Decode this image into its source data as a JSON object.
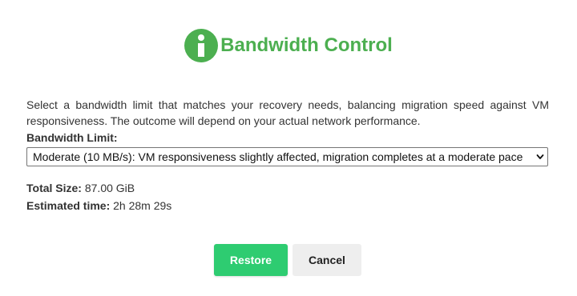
{
  "dialog": {
    "title": "Bandwidth Control",
    "icon": "info-icon",
    "accent_color": "#4caf50",
    "description": "Select a bandwidth limit that matches your recovery needs, balancing migration speed against VM responsiveness. The outcome will depend on your actual network performance.",
    "bandwidth_label": "Bandwidth Limit:",
    "bandwidth_selected": "Moderate (10 MB/s): VM responsiveness slightly affected, migration completes at a moderate pace",
    "total_size_label": "Total Size:",
    "total_size_value": "87.00 GiB",
    "estimated_time_label": "Estimated time:",
    "estimated_time_value": "2h 28m 29s"
  },
  "buttons": {
    "restore_label": "Restore",
    "restore_color": "#2ecc71",
    "cancel_label": "Cancel"
  }
}
